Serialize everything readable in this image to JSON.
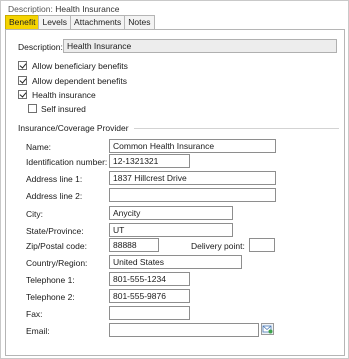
{
  "header": {
    "description_label": "Description:",
    "description_value": "Health Insurance"
  },
  "tabs": [
    {
      "label": "Benefit",
      "active": true
    },
    {
      "label": "Levels"
    },
    {
      "label": "Attachments"
    },
    {
      "label": "Notes"
    }
  ],
  "benefit": {
    "description_label": "Description:",
    "description_value": "Health Insurance",
    "allow_beneficiary": {
      "label": "Allow beneficiary benefits",
      "checked": true
    },
    "allow_dependent": {
      "label": "Allow dependent benefits",
      "checked": true
    },
    "health_insurance": {
      "label": "Health insurance",
      "checked": true
    },
    "self_insured": {
      "label": "Self insured",
      "checked": false
    }
  },
  "provider": {
    "section_title": "Insurance/Coverage Provider",
    "name": {
      "label": "Name:",
      "value": "Common Health Insurance"
    },
    "identification": {
      "label": "Identification number:",
      "value": "12-1321321"
    },
    "address1": {
      "label": "Address line 1:",
      "value": "1837 Hillcrest Drive"
    },
    "address2": {
      "label": "Address line 2:",
      "value": ""
    },
    "city": {
      "label": "City:",
      "value": "Anycity"
    },
    "state": {
      "label": "State/Province:",
      "value": "UT"
    },
    "zip": {
      "label": "Zip/Postal code:",
      "value": "88888"
    },
    "delivery_point": {
      "label": "Delivery point:",
      "value": ""
    },
    "country": {
      "label": "Country/Region:",
      "value": "United States"
    },
    "telephone1": {
      "label": "Telephone 1:",
      "value": "801-555-1234"
    },
    "telephone2": {
      "label": "Telephone 2:",
      "value": "801-555-9876"
    },
    "fax": {
      "label": "Fax:",
      "value": ""
    },
    "email": {
      "label": "Email:",
      "value": ""
    },
    "email_button_icon": "send-mail-icon"
  },
  "colors": {
    "active_tab": "#f5d400",
    "readonly_field": "#ededed"
  }
}
